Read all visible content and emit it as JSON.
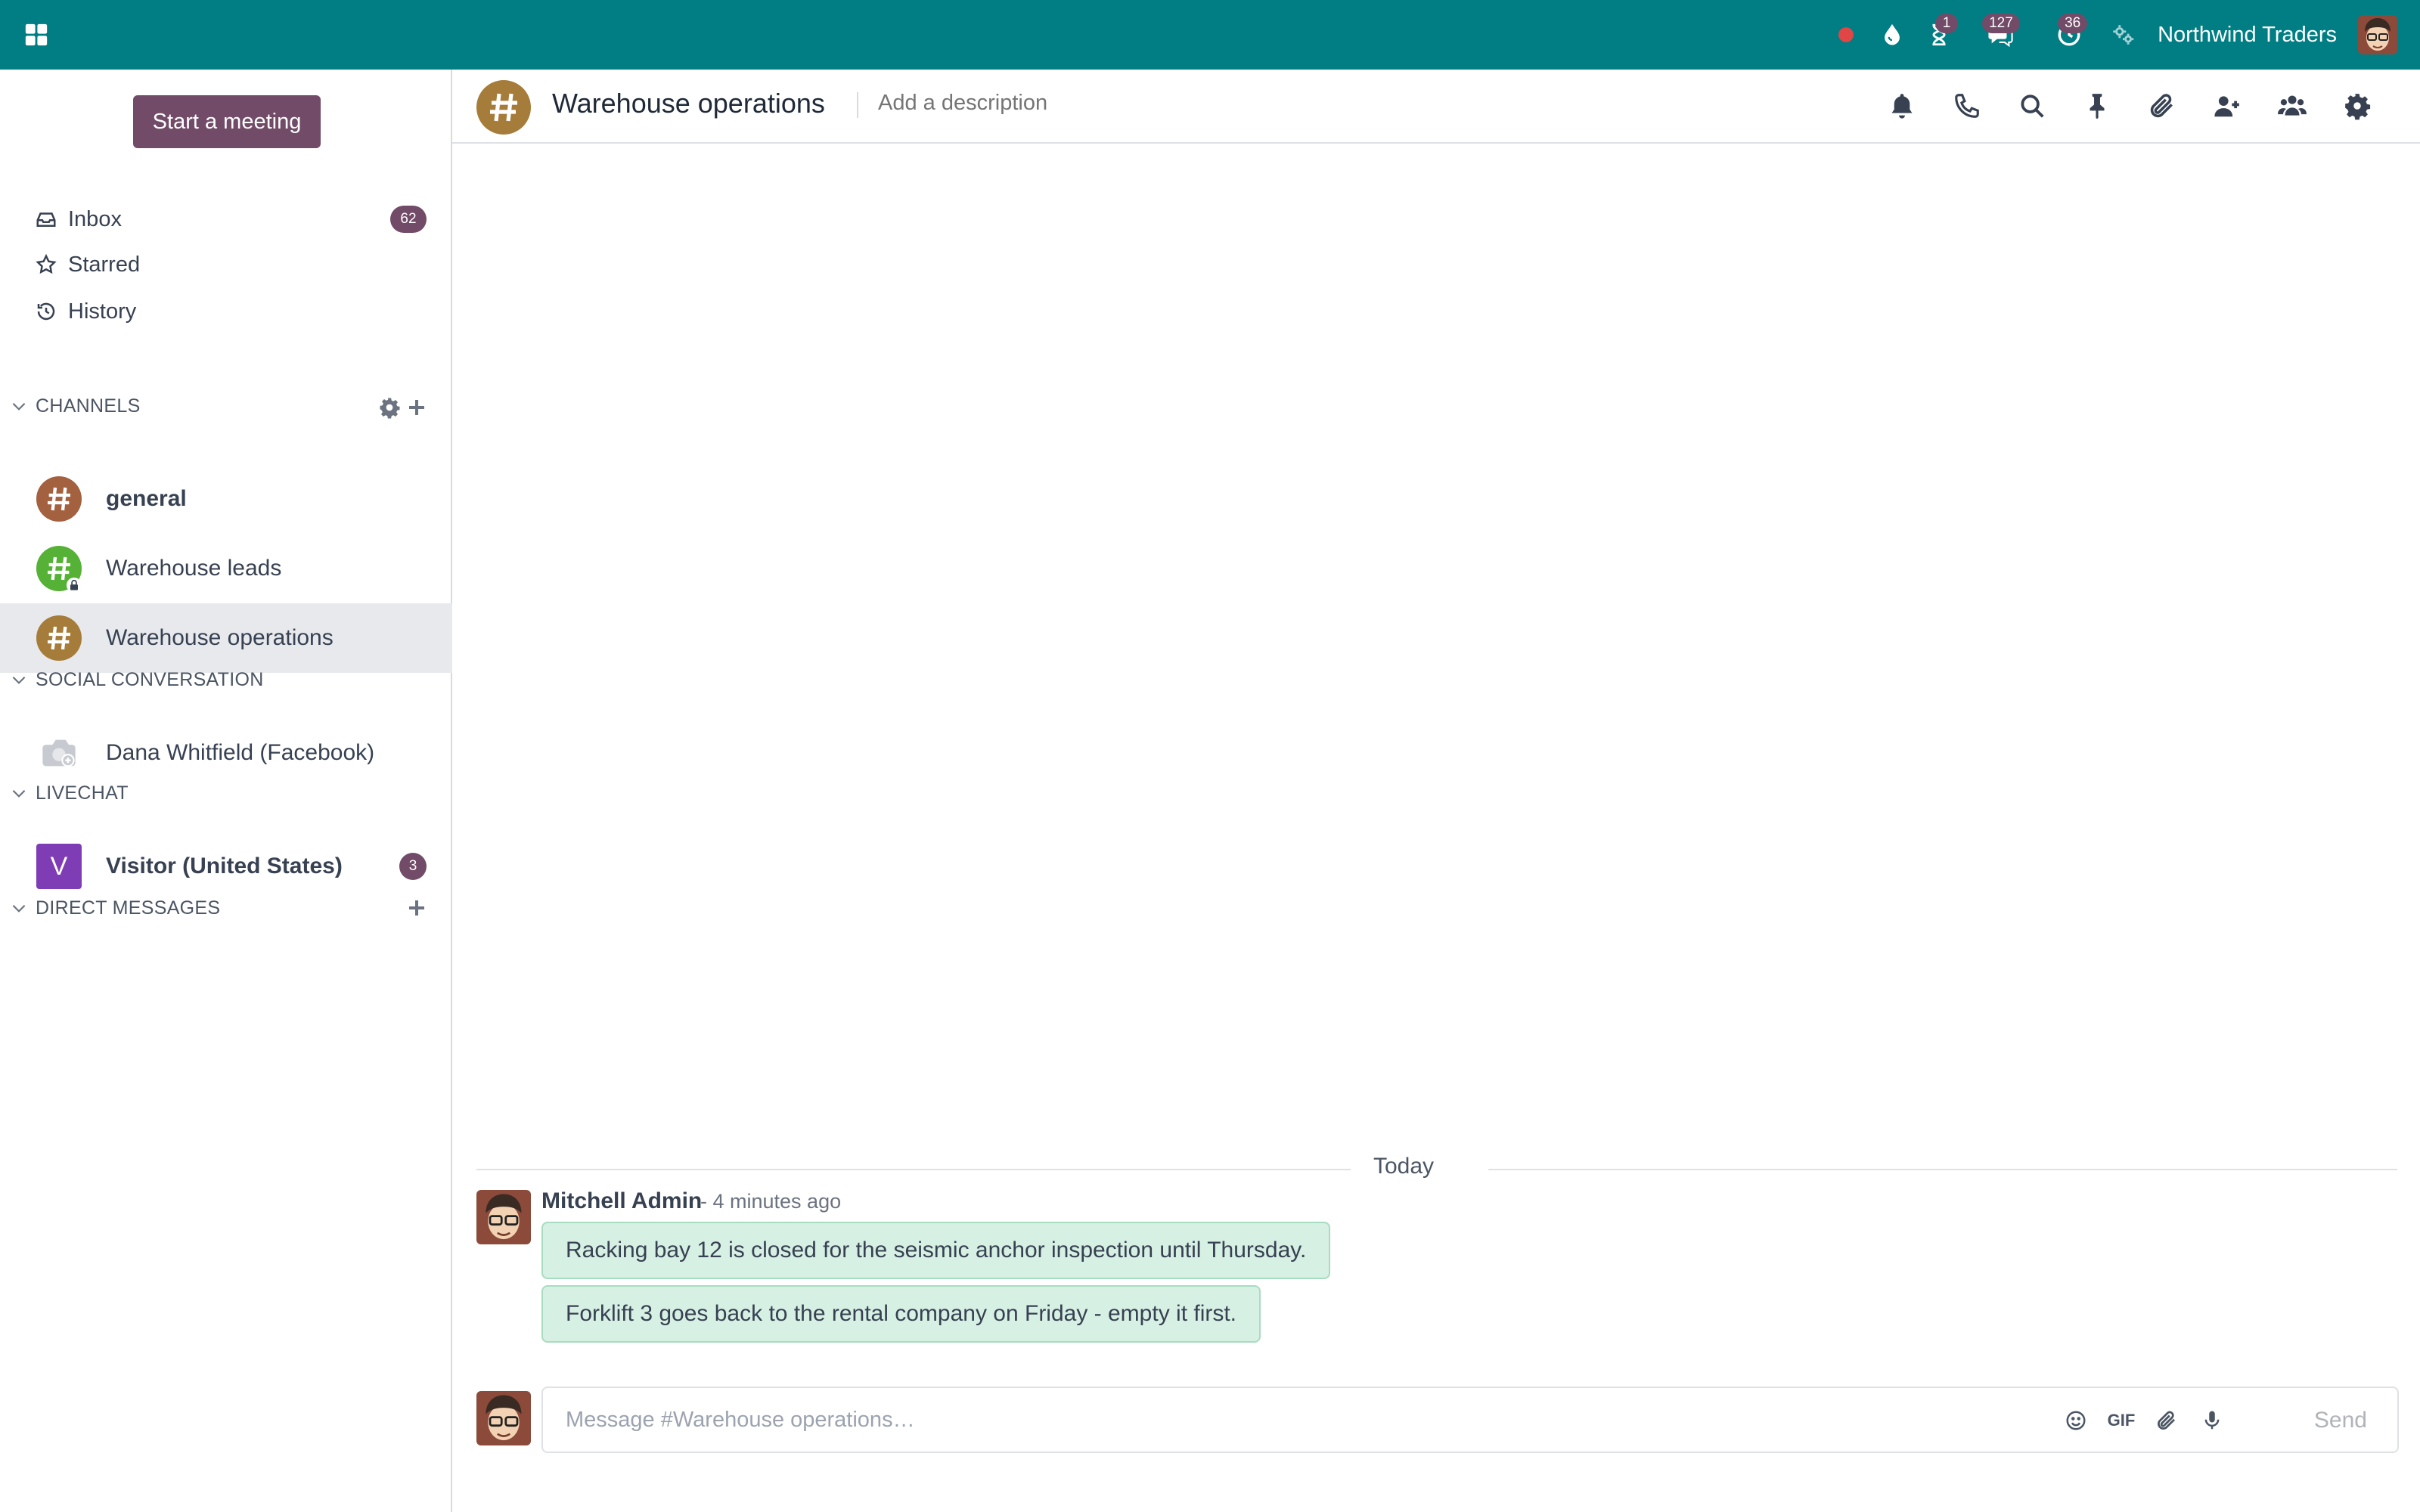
{
  "navbar": {
    "company": "Northwind Traders",
    "brand_color": "#017e84",
    "systray": {
      "activity_badge": "1",
      "messages_badge": "127",
      "timeoff_badge": "36"
    }
  },
  "sidebar": {
    "start_meeting": "Start a meeting",
    "mailboxes": [
      {
        "label": "Inbox",
        "icon": "inbox-icon",
        "count": "62"
      },
      {
        "label": "Starred",
        "icon": "star-icon"
      },
      {
        "label": "History",
        "icon": "history-icon"
      }
    ],
    "categories": {
      "channels": "CHANNELS",
      "social": "SOCIAL CONVERSATION",
      "livechat": "LIVECHAT",
      "direct": "DIRECT MESSAGES"
    },
    "channels": [
      {
        "name": "general",
        "color": "#a3613f",
        "bold": true
      },
      {
        "name": "Warehouse leads",
        "color": "#55b236",
        "private": true
      },
      {
        "name": "Warehouse operations",
        "color": "#a67c3a",
        "active": true
      }
    ],
    "social": [
      {
        "name": "Dana Whitfield (Facebook)"
      }
    ],
    "livechat": [
      {
        "name": "Visitor (United States)",
        "initial": "V",
        "count": "3"
      }
    ]
  },
  "thread": {
    "title": "Warehouse operations",
    "description_placeholder": "Add a description",
    "day_separator": "Today",
    "message": {
      "author": "Mitchell Admin",
      "time": "- 4 minutes ago",
      "bodies": [
        "Racking bay 12 is closed for the seismic anchor inspection until Thursday.",
        "Forklift 3 goes back to the rental company on Friday - empty it first."
      ]
    },
    "composer": {
      "placeholder": "Message #Warehouse operations…",
      "gif_label": "GIF",
      "send_label": "Send"
    }
  },
  "colors": {
    "accent": "#714b67",
    "bubble": "#d7f0e4",
    "visitor": "#7e3db4"
  }
}
